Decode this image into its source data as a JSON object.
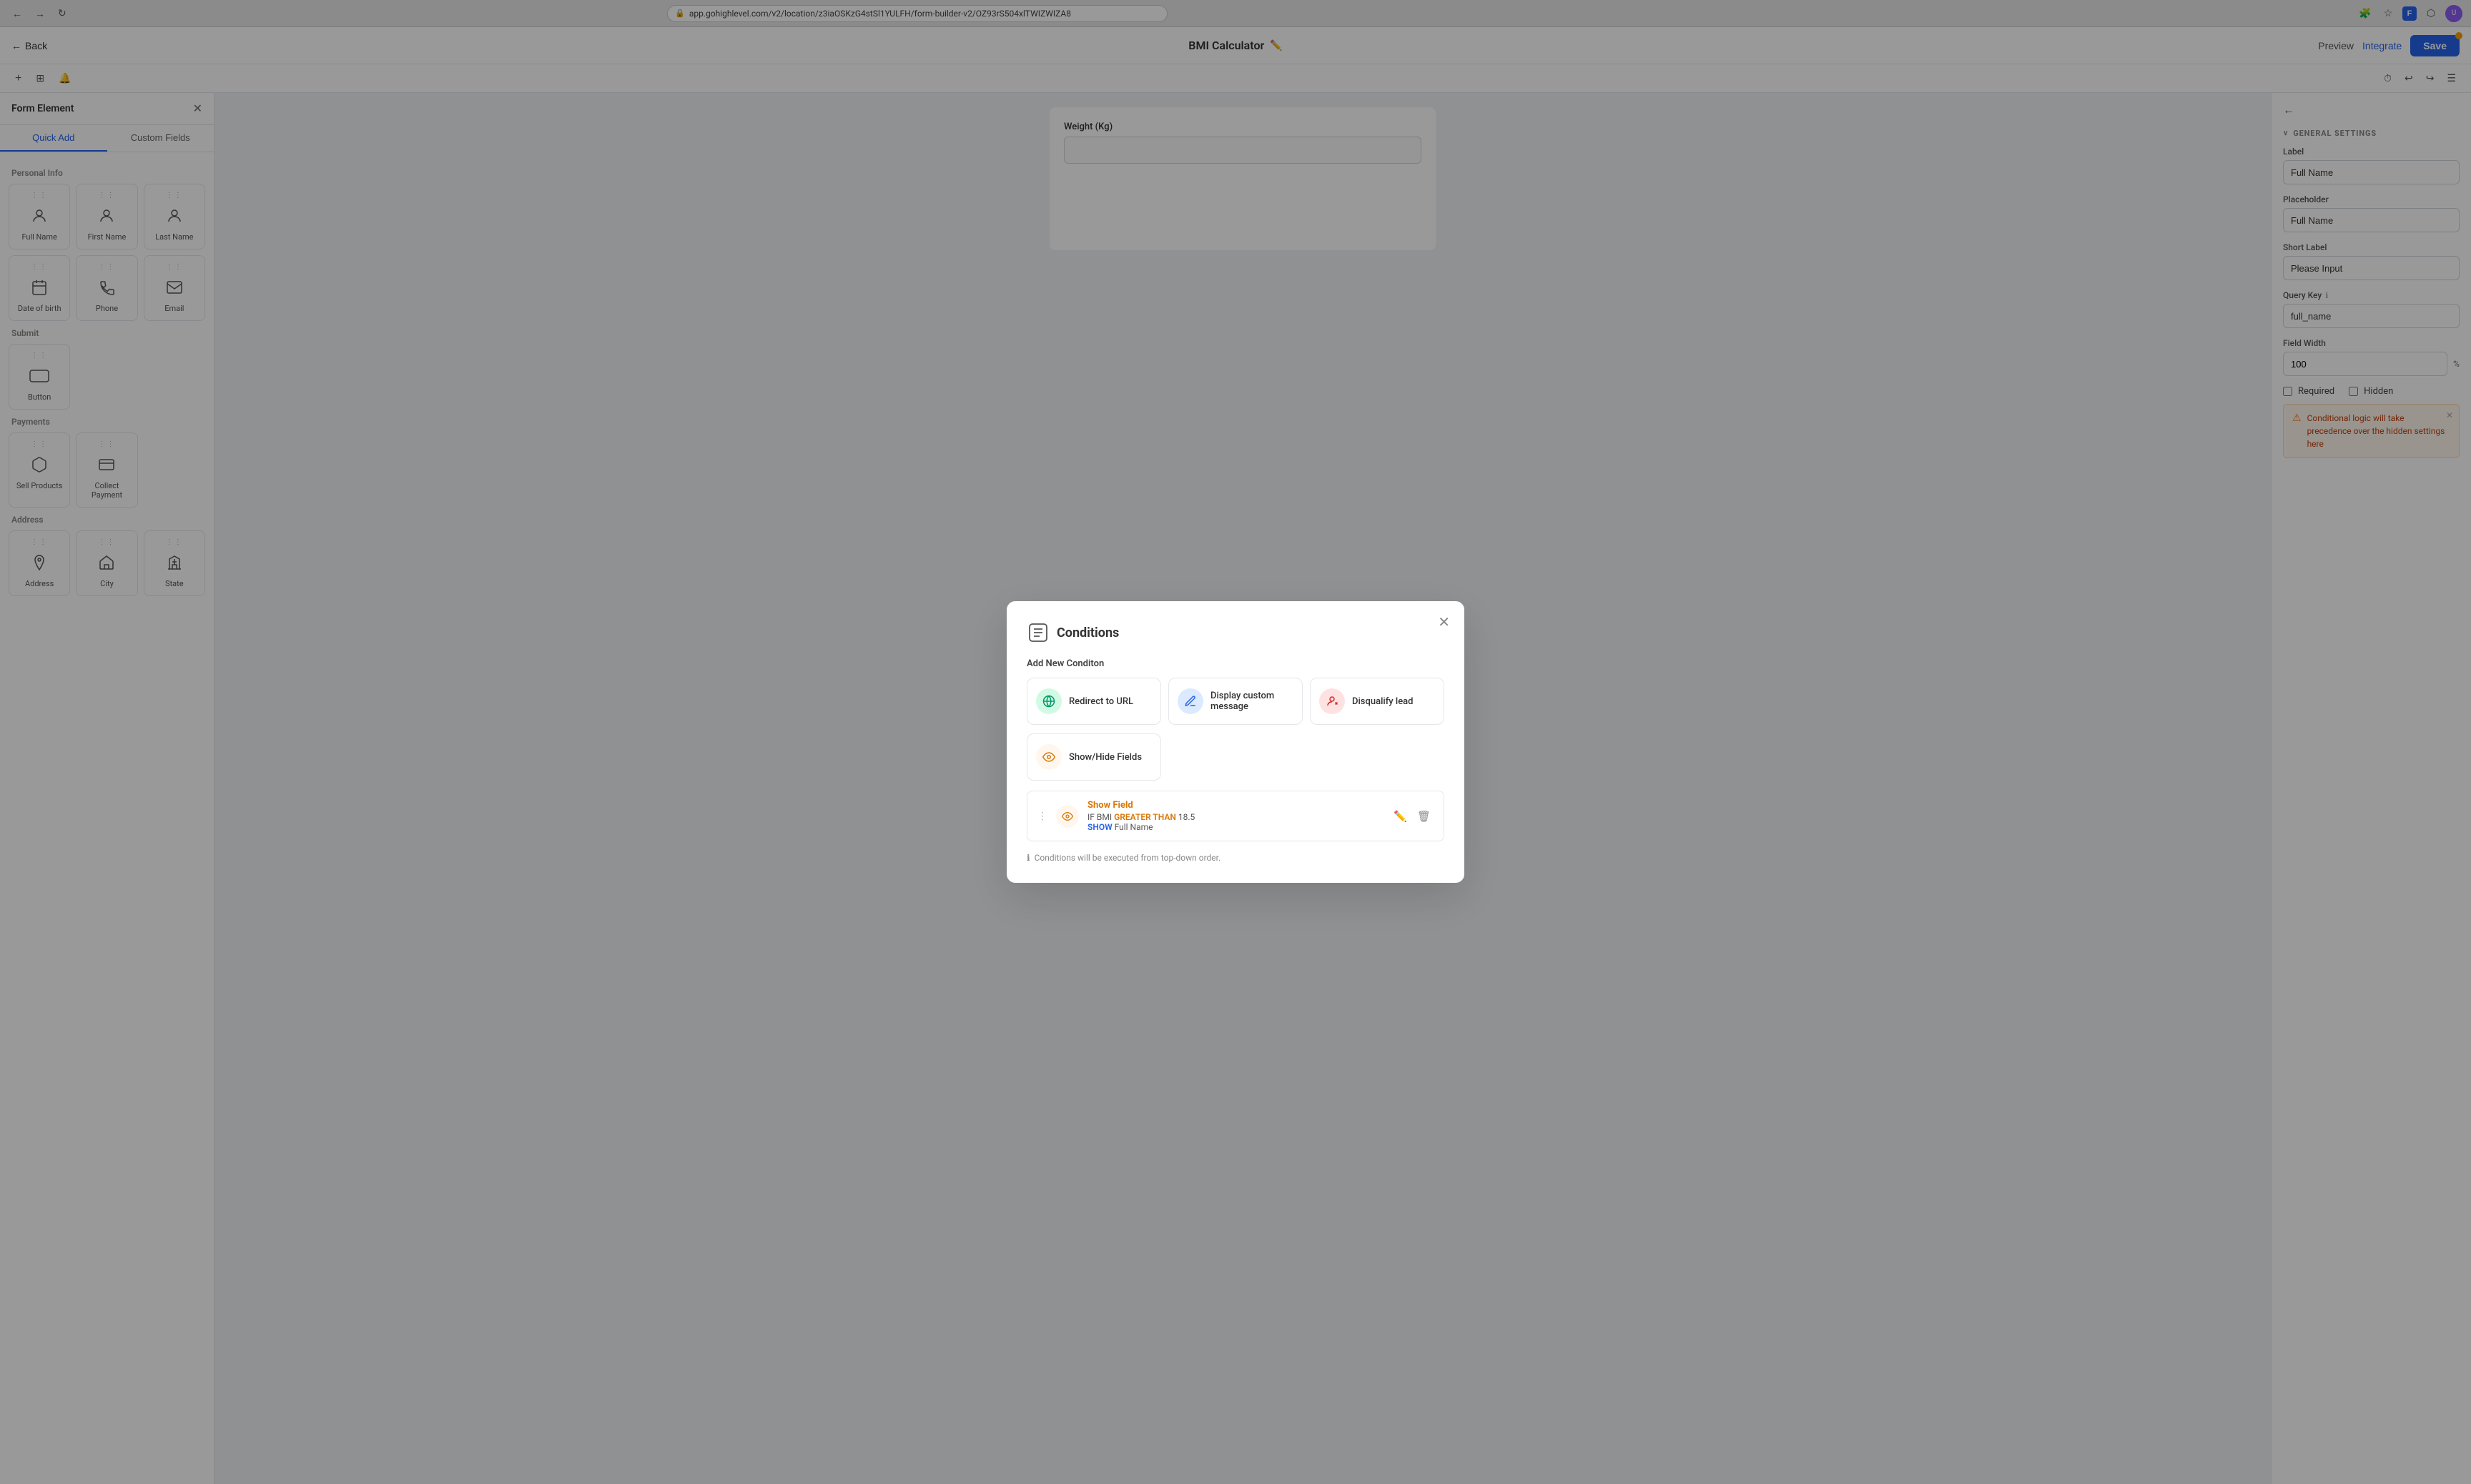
{
  "browser": {
    "url": "app.gohighlevel.com/v2/location/z3iaOSKzG4stSl1YULFH/form-builder-v2/OZ93rS504xlTWIZWIZA8"
  },
  "header": {
    "back_label": "Back",
    "title": "BMI Calculator",
    "edit_icon": "✏️",
    "preview_label": "Preview",
    "integrate_label": "Integrate",
    "save_label": "Save"
  },
  "subtoolbar": {
    "add_icon": "+",
    "grid_icon": "⊞",
    "bell_icon": "🔔",
    "history_icon": "⏱",
    "undo_icon": "↩",
    "redo_icon": "↪",
    "settings_icon": "≡"
  },
  "left_sidebar": {
    "title": "Form Element",
    "tabs": [
      {
        "id": "quick-add",
        "label": "Quick Add",
        "active": false
      },
      {
        "id": "custom-fields",
        "label": "Custom Fields",
        "active": false
      }
    ],
    "sections": {
      "personal_info": {
        "title": "Personal Info",
        "fields": [
          {
            "id": "full-name",
            "label": "Full Name",
            "icon": "👤"
          },
          {
            "id": "first-name",
            "label": "First Name",
            "icon": "👤"
          },
          {
            "id": "last-name",
            "label": "Last Name",
            "icon": "👤"
          },
          {
            "id": "date-of-birth",
            "label": "Date of birth",
            "icon": "📅"
          },
          {
            "id": "phone",
            "label": "Phone",
            "icon": "📞"
          },
          {
            "id": "email",
            "label": "Email",
            "icon": "✉️"
          }
        ]
      },
      "submit": {
        "title": "Submit",
        "fields": [
          {
            "id": "button",
            "label": "Button",
            "icon": "⬜"
          }
        ]
      },
      "payments": {
        "title": "Payments",
        "fields": [
          {
            "id": "sell-products",
            "label": "Sell Products",
            "icon": "📦"
          },
          {
            "id": "collect-payment",
            "label": "Collect Payment",
            "icon": "💳"
          }
        ]
      },
      "address": {
        "title": "Address",
        "fields": [
          {
            "id": "address",
            "label": "Address",
            "icon": "📍"
          },
          {
            "id": "city",
            "label": "City",
            "icon": "🏙"
          },
          {
            "id": "state",
            "label": "State",
            "icon": "🏛"
          }
        ]
      }
    }
  },
  "canvas": {
    "form_field_label": "Weight (Kg)"
  },
  "modal": {
    "title": "Conditions",
    "section_title": "Add New Conditon",
    "options": [
      {
        "id": "redirect-url",
        "label": "Redirect to URL",
        "icon": "🌐",
        "icon_class": "icon-green"
      },
      {
        "id": "display-custom-message",
        "label": "Display custom message",
        "icon": "✏️",
        "icon_class": "icon-blue"
      },
      {
        "id": "disqualify-lead",
        "label": "Disqualify lead",
        "icon": "👤",
        "icon_class": "icon-red"
      },
      {
        "id": "show-hide-fields",
        "label": "Show/Hide Fields",
        "icon": "⊙",
        "icon_class": "icon-orange"
      }
    ],
    "existing_conditions": [
      {
        "id": "condition-1",
        "title": "Show Field",
        "rule_if": "IF",
        "rule_field": "BMI",
        "rule_operator": "GREATER THAN",
        "rule_value": "18.5",
        "rule_action": "SHOW",
        "rule_target": "Full Name"
      }
    ],
    "footer_text": "Conditions will be executed from top-down order."
  },
  "right_sidebar": {
    "section_title": "GENERAL SETTINGS",
    "fields": {
      "label": {
        "title": "Label",
        "value": "Full Name"
      },
      "placeholder": {
        "title": "Placeholder",
        "value": "Full Name"
      },
      "short_label": {
        "title": "Short Label",
        "value": "Please Input"
      },
      "query_key": {
        "title": "Query Key",
        "value": "full_name"
      },
      "field_width": {
        "title": "Field Width",
        "value": "100",
        "unit": "%"
      }
    },
    "required_label": "Required",
    "hidden_label": "Hidden",
    "warning_text": "Conditional logic will take precedence over the hidden settings here"
  }
}
